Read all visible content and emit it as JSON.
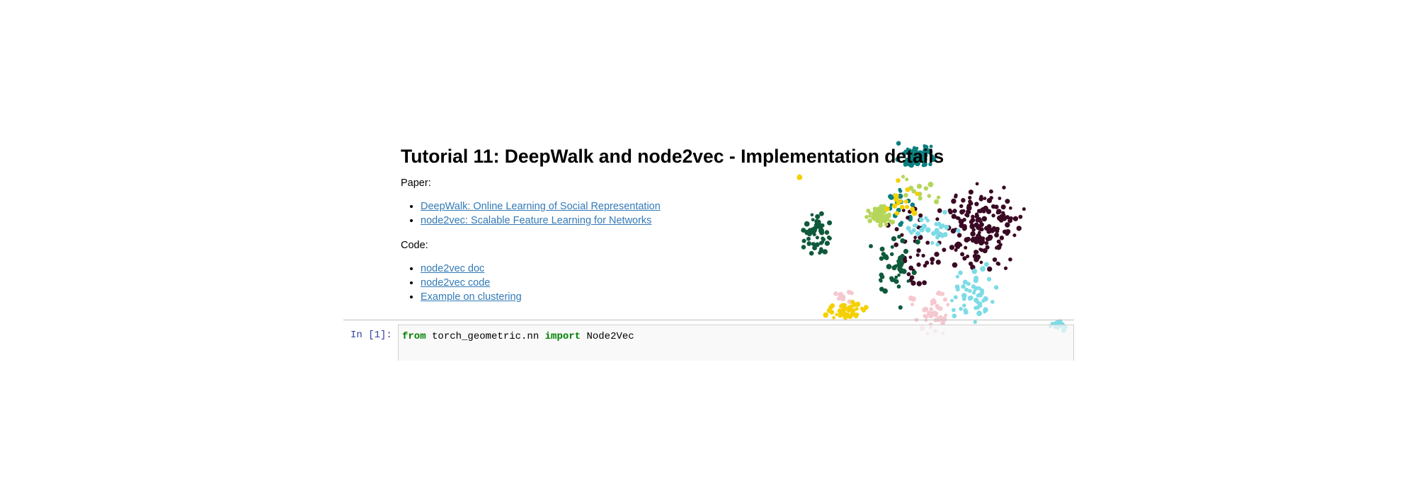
{
  "markdown": {
    "title": "Tutorial 11: DeepWalk and node2vec - Implementation details",
    "paper_label": "Paper:",
    "paper_links": [
      "DeepWalk: Online Learning of Social Representation",
      "node2vec: Scalable Feature Learning for Networks"
    ],
    "code_label": "Code:",
    "code_links": [
      "node2vec doc",
      "node2vec code",
      "Example on clustering"
    ]
  },
  "code_cell": {
    "prompt": "In [1]:",
    "tokens": [
      "from",
      " torch_geometric.nn ",
      "import",
      " Node2Vec"
    ]
  },
  "scatter": {
    "cluster_colors": [
      "#0b7f7f",
      "#3a0a24",
      "#0f5a3b",
      "#b5d65a",
      "#f5c8cf",
      "#7ddbe6",
      "#f5d000"
    ]
  }
}
